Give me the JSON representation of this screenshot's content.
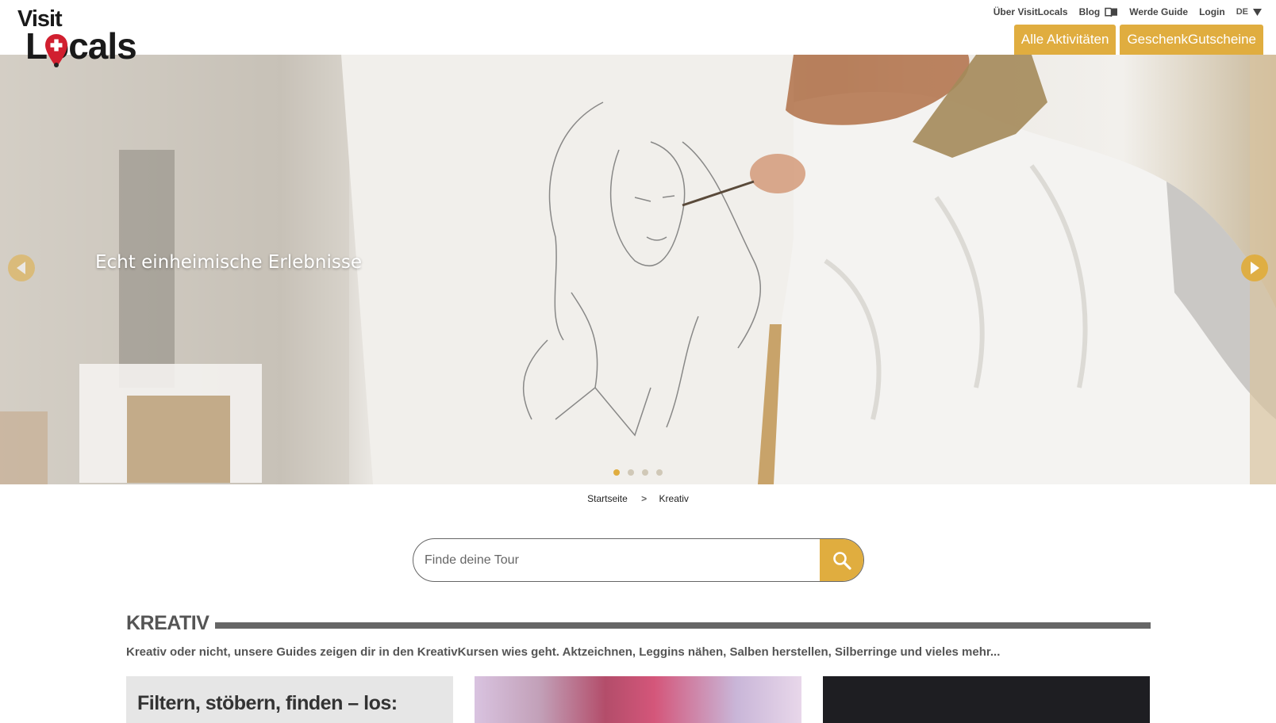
{
  "brand": {
    "visit": "Visit",
    "locals": "Locals"
  },
  "topnav": {
    "about": "Über VisitLocals",
    "blog": "Blog",
    "become_guide": "Werde Guide",
    "login": "Login",
    "language": "DE"
  },
  "buttons": {
    "all_activities": "Alle Aktivitäten",
    "gift_vouchers": "GeschenkGutscheine"
  },
  "hero": {
    "caption": "Echt einheimische Erlebnisse",
    "slide_count": 4,
    "active_slide": 1
  },
  "breadcrumb": {
    "home": "Startseite",
    "separator": ">",
    "current": "Kreativ"
  },
  "search": {
    "placeholder": "Finde deine Tour",
    "value": ""
  },
  "section": {
    "title": "KREATIV",
    "description": "Kreativ oder nicht, unsere Guides zeigen dir in den KreativKursen wies geht. Aktzeichnen, Leggins nähen, Salben herstellen, Silberringe und vieles mehr..."
  },
  "cards": {
    "filter_title": "Filtern, stöbern, finden – los:"
  },
  "colors": {
    "accent": "#e0ad3f",
    "text": "#555555",
    "brand_red": "#d11f2f"
  }
}
